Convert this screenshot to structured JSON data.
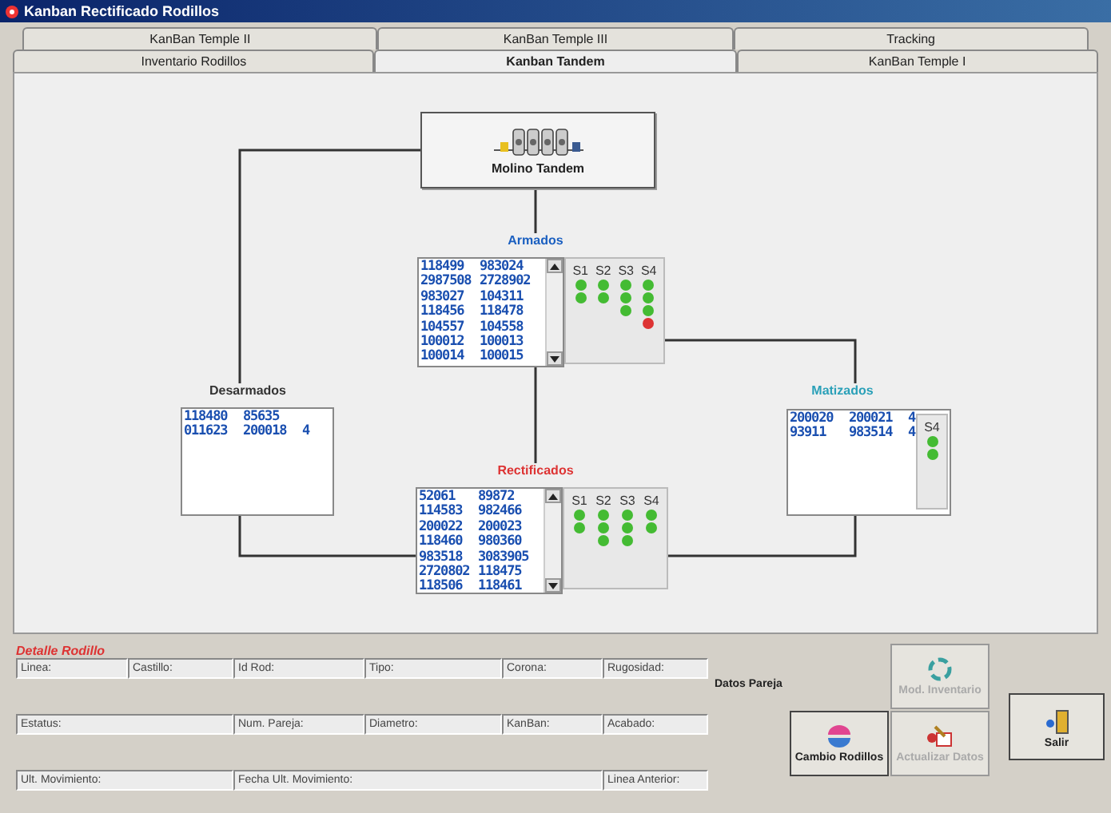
{
  "window": {
    "title": "Kanban Rectificado Rodillos"
  },
  "tab_rows": [
    {
      "tabs": [
        {
          "label": "KanBan Temple II",
          "selected": false
        },
        {
          "label": "KanBan Temple III",
          "selected": false
        },
        {
          "label": "Tracking",
          "selected": false
        }
      ]
    },
    {
      "tabs": [
        {
          "label": "Inventario Rodillos",
          "selected": false
        },
        {
          "label": "Kanban Tandem",
          "selected": true
        },
        {
          "label": "KanBan Temple I",
          "selected": false
        }
      ]
    }
  ],
  "mill": {
    "label": "Molino Tandem"
  },
  "stations": [
    {
      "kind": "armados",
      "title": "Armados",
      "color": "#1a5fc0",
      "scroll": true,
      "rows": [
        [
          "118499",
          "983024"
        ],
        [
          "2987508",
          "2728902"
        ],
        [
          "983027",
          "104311"
        ],
        [
          "118456",
          "118478"
        ],
        [
          "104557",
          "104558"
        ],
        [
          "100012",
          "100013"
        ],
        [
          "100014",
          "100015"
        ]
      ],
      "sensors": [
        {
          "label": "S1",
          "dots": [
            {
              "color": "#44bb33"
            },
            {
              "color": "#44bb33"
            }
          ]
        },
        {
          "label": "S2",
          "dots": [
            {
              "color": "#44bb33"
            },
            {
              "color": "#44bb33"
            }
          ]
        },
        {
          "label": "S3",
          "dots": [
            {
              "color": "#44bb33"
            },
            {
              "color": "#44bb33"
            },
            {
              "color": "#44bb33"
            }
          ]
        },
        {
          "label": "S4",
          "dots": [
            {
              "color": "#44bb33"
            },
            {
              "color": "#44bb33"
            },
            {
              "color": "#44bb33"
            },
            {
              "color": "#dd3333"
            }
          ]
        }
      ]
    },
    {
      "kind": "desarmados",
      "title": "Desarmados",
      "color": "#333333",
      "scroll": false,
      "rows": [
        [
          "118480",
          "85635"
        ],
        [
          "011623",
          "200018",
          "4"
        ]
      ]
    },
    {
      "kind": "matizados",
      "title": "Matizados",
      "color": "#2aa0b8",
      "scroll": false,
      "rows": [
        [
          "200020",
          "200021",
          "4"
        ],
        [
          "93911",
          "983514",
          "4"
        ]
      ],
      "sensors": [
        {
          "label": "S4",
          "dots": [
            {
              "color": "#44bb33"
            },
            {
              "color": "#44bb33"
            }
          ]
        }
      ]
    },
    {
      "kind": "rectificados",
      "title": "Rectificados",
      "color": "#dd3333",
      "scroll": true,
      "rows": [
        [
          "52061",
          "89872"
        ],
        [
          "114583",
          "982466"
        ],
        [
          "200022",
          "200023"
        ],
        [
          "118460",
          "980360"
        ],
        [
          "983518",
          "3083905"
        ],
        [
          "2720802",
          "118475"
        ],
        [
          "118506",
          "118461"
        ]
      ],
      "sensors": [
        {
          "label": "S1",
          "dots": [
            {
              "color": "#44bb33"
            },
            {
              "color": "#44bb33"
            }
          ]
        },
        {
          "label": "S2",
          "dots": [
            {
              "color": "#44bb33"
            },
            {
              "color": "#44bb33"
            },
            {
              "color": "#44bb33"
            }
          ]
        },
        {
          "label": "S3",
          "dots": [
            {
              "color": "#44bb33"
            },
            {
              "color": "#44bb33"
            },
            {
              "color": "#44bb33"
            }
          ]
        },
        {
          "label": "S4",
          "dots": [
            {
              "color": "#44bb33"
            },
            {
              "color": "#44bb33"
            }
          ]
        }
      ]
    }
  ],
  "detail": {
    "title": "Detalle Rodillo",
    "fields": [
      {
        "label": "Linea:"
      },
      {
        "label": "Castillo:"
      },
      {
        "label": "Id Rod:"
      },
      {
        "label": "Tipo:"
      },
      {
        "label": "Corona:"
      },
      {
        "label": "Rugosidad:"
      },
      {
        "label": "Estatus:"
      },
      {
        "label": "Num. Pareja:"
      },
      {
        "label": "Diametro:"
      },
      {
        "label": "KanBan:"
      },
      {
        "label": "Acabado:"
      },
      {
        "label": "Ult. Movimiento:"
      },
      {
        "label": "Fecha Ult. Movimiento:"
      },
      {
        "label": "Linea Anterior:"
      }
    ]
  },
  "pair_label": "Datos Pareja",
  "buttons": [
    {
      "kind": "inventory",
      "label": "Mod. Inventario",
      "disabled": true
    },
    {
      "kind": "change",
      "label": "Cambio Rodillos",
      "disabled": false
    },
    {
      "kind": "update",
      "label": "Actualizar Datos",
      "disabled": true
    }
  ],
  "exit_button": {
    "label": "Salir"
  }
}
